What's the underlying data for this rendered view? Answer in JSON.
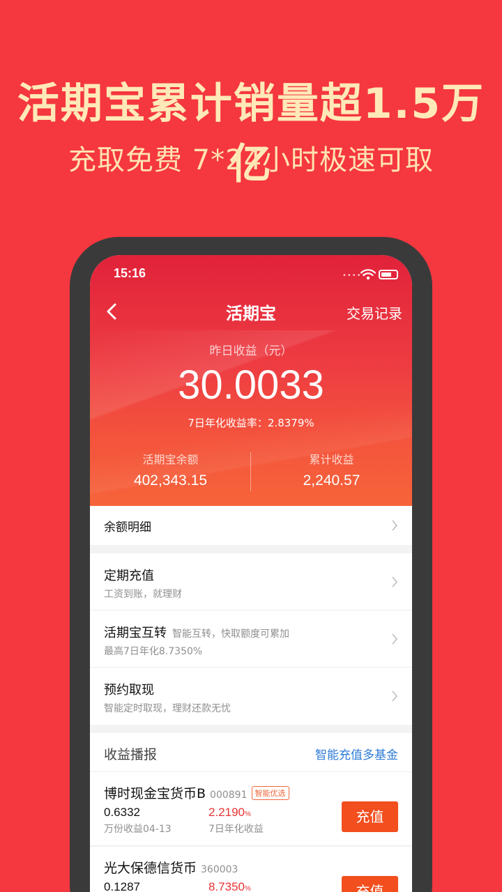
{
  "promo": {
    "title": "活期宝累计销量超1.5万亿",
    "subtitle": "充取免费  7*24小时极速可取"
  },
  "status_bar": {
    "time": "15:16",
    "signal": "•••••"
  },
  "nav": {
    "title": "活期宝",
    "right_link": "交易记录"
  },
  "hero": {
    "yesterday_label": "昨日收益（元）",
    "yesterday_value": "30.0033",
    "rate_text": "7日年化收益率：2.8379%",
    "balance_label": "活期宝余额",
    "balance_value": "402,343.15",
    "total_label": "累计收益",
    "total_value": "2,240.57"
  },
  "menu": {
    "balance_detail": "余额明细",
    "items": [
      {
        "title": "定期充值",
        "inline": "",
        "sub": "工资到账，就理财"
      },
      {
        "title": "活期宝互转",
        "inline": "智能互转，快取额度可累加",
        "sub": "最高7日年化8.7350%"
      },
      {
        "title": "预约取现",
        "inline": "",
        "sub": "智能定时取现，理财还款无忧"
      }
    ]
  },
  "earnings": {
    "header": "收益播报",
    "link": "智能充值多基金",
    "funds": [
      {
        "name": "博时现金宝货币B",
        "code": "000891",
        "tag": "智能优选",
        "per_10k_value": "0.6332",
        "per_10k_label": "万份收益04-13",
        "rate_value": "2.2190",
        "rate_unit": "%",
        "rate_label": "7日年化收益",
        "button": "充值"
      },
      {
        "name": "光大保德信货币",
        "code": "360003",
        "tag": "",
        "per_10k_value": "0.1287",
        "per_10k_label": "",
        "rate_value": "8.7350",
        "rate_unit": "%",
        "rate_label": "",
        "button": "充值"
      }
    ]
  },
  "colors": {
    "background": "#F5373F",
    "promo_text": "#FFE9B8",
    "accent_red": "#E93334",
    "button": "#F24E1E",
    "link_blue": "#2E7BD6"
  }
}
